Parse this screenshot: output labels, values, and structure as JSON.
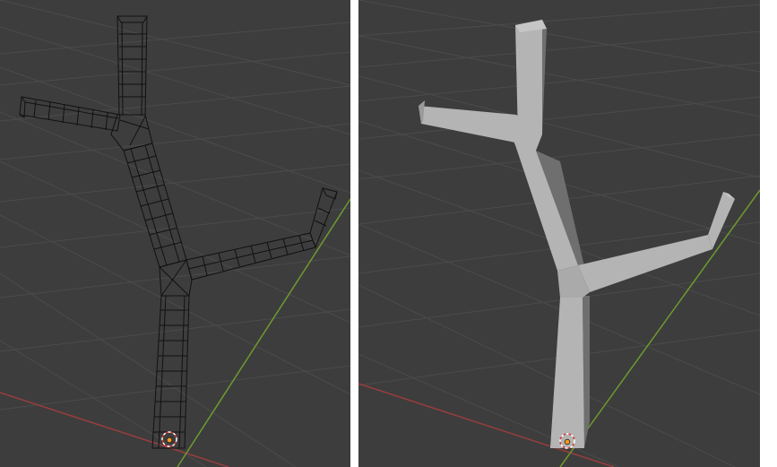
{
  "viewports": [
    {
      "id": "left",
      "mode": "wireframe"
    },
    {
      "id": "right",
      "mode": "solid"
    }
  ],
  "colors": {
    "background": "#3d3d3d",
    "grid_line": "#4b4b4b",
    "x_axis": "#9a3d3d",
    "y_axis": "#6e9a2e",
    "wire": "#101010",
    "mesh_light": "#b4b4b4",
    "mesh_shadow": "#6f6f6f",
    "origin": "#ff9a1a"
  },
  "icons": {
    "origin": "object-origin-icon",
    "cursor": "3d-cursor-icon"
  }
}
